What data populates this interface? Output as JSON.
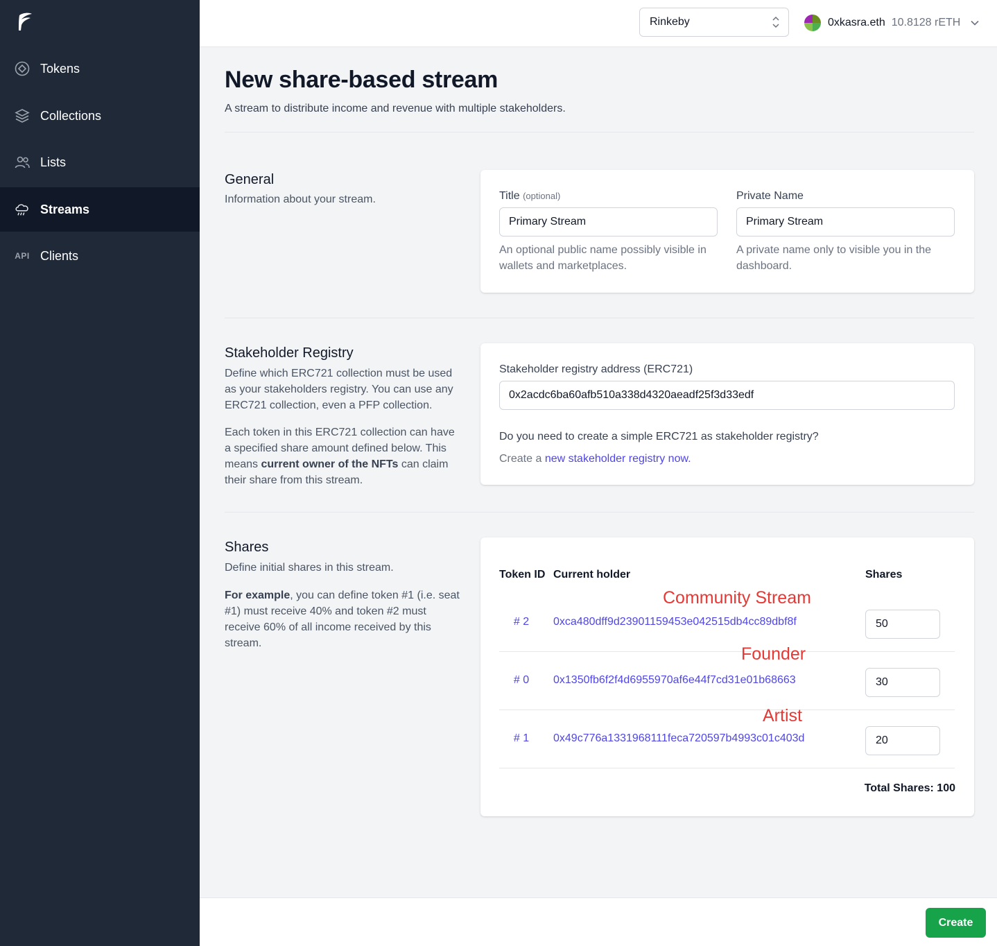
{
  "sidebar": {
    "items": [
      {
        "label": "Tokens",
        "icon": "token-icon"
      },
      {
        "label": "Collections",
        "icon": "collections-icon"
      },
      {
        "label": "Lists",
        "icon": "users-icon"
      },
      {
        "label": "Streams",
        "icon": "cloud-rain-icon",
        "active": true
      },
      {
        "label": "Clients",
        "icon": "api-icon",
        "icon_text": "API"
      }
    ]
  },
  "topbar": {
    "network": "Rinkeby",
    "account_name": "0xkasra.eth",
    "account_balance": "10.8128 rETH"
  },
  "page": {
    "title": "New share-based stream",
    "subtitle": "A stream to distribute income and revenue with multiple stakeholders."
  },
  "general": {
    "title": "General",
    "description": "Information about your stream.",
    "title_label": "Title",
    "title_optional": "(optional)",
    "title_value": "Primary Stream",
    "title_help": "An optional public name possibly visible in wallets and marketplaces.",
    "private_label": "Private Name",
    "private_value": "Primary Stream",
    "private_help": "A private name only to visible you in the dashboard."
  },
  "registry": {
    "title": "Stakeholder Registry",
    "description_1": "Define which ERC721 collection must be used as your stakeholders registry. You can use any ERC721 collection, even a PFP collection.",
    "description_2_pre": "Each token in this ERC721 collection can have a specified share amount defined below. This means ",
    "description_2_bold": "current owner of the NFTs",
    "description_2_post": " can claim their share from this stream.",
    "address_label": "Stakeholder registry address (ERC721)",
    "address_value": "0x2acdc6ba60afb510a338d4320aeadf25f3d33edf",
    "question": "Do you need to create a simple ERC721 as stakeholder registry?",
    "create_prefix": "Create a ",
    "create_link": "new stakeholder registry now."
  },
  "shares": {
    "title": "Shares",
    "description": "Define initial shares in this stream.",
    "example_bold": "For example",
    "example_text": ", you can define token #1 (i.e. seat #1) must receive 40% and token #2 must receive 60% of all income received by this stream.",
    "headers": {
      "token_id": "Token ID",
      "holder": "Current holder",
      "shares": "Shares"
    },
    "rows": [
      {
        "token_id": "# 2",
        "holder": "0xca480dff9d23901159453e042515db4cc89dbf8f",
        "shares": "50",
        "annotation": "Community Stream"
      },
      {
        "token_id": "# 0",
        "holder": "0x1350fb6f2f4d6955970af6e44f7cd31e01b68663",
        "shares": "30",
        "annotation": "Founder"
      },
      {
        "token_id": "# 1",
        "holder": "0x49c776a1331968111feca720597b4993c01c403d",
        "shares": "20",
        "annotation": "Artist"
      }
    ],
    "total": "Total Shares: 100"
  },
  "footer": {
    "create_label": "Create"
  },
  "colors": {
    "sidebar_bg": "#1f2937",
    "accent": "#4f46e5",
    "create_button": "#16a34a",
    "annotation": "#e53935"
  }
}
